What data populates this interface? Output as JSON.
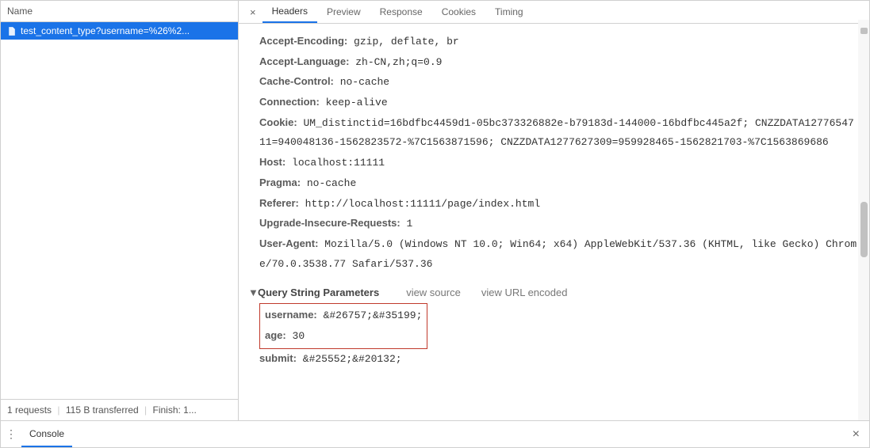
{
  "sidebar": {
    "header": "Name",
    "item_label": "test_content_type?username=%26%2...",
    "footer": {
      "requests": "1 requests",
      "transferred": "115 B transferred",
      "finish": "Finish: 1..."
    }
  },
  "tabs": {
    "headers": "Headers",
    "preview": "Preview",
    "response": "Response",
    "cookies": "Cookies",
    "timing": "Timing"
  },
  "headers": {
    "accept_encoding_k": "Accept-Encoding:",
    "accept_encoding_v": "gzip, deflate, br",
    "accept_language_k": "Accept-Language:",
    "accept_language_v": "zh-CN,zh;q=0.9",
    "cache_control_k": "Cache-Control:",
    "cache_control_v": "no-cache",
    "connection_k": "Connection:",
    "connection_v": "keep-alive",
    "cookie_k": "Cookie:",
    "cookie_v": "UM_distinctid=16bdfbc4459d1-05bc373326882e-b79183d-144000-16bdfbc445a2f; CNZZDATA1277654711=940048136-1562823572-%7C1563871596; CNZZDATA1277627309=959928465-1562821703-%7C1563869686",
    "host_k": "Host:",
    "host_v": "localhost:11111",
    "pragma_k": "Pragma:",
    "pragma_v": "no-cache",
    "referer_k": "Referer:",
    "referer_v": "http://localhost:11111/page/index.html",
    "upgrade_k": "Upgrade-Insecure-Requests:",
    "upgrade_v": "1",
    "user_agent_k": "User-Agent:",
    "user_agent_v": "Mozilla/5.0 (Windows NT 10.0; Win64; x64) AppleWebKit/537.36 (KHTML, like Gecko) Chrome/70.0.3538.77 Safari/537.36"
  },
  "query_section": {
    "title": "Query String Parameters",
    "view_source": "view source",
    "view_encoded": "view URL encoded",
    "params": {
      "username_k": "username:",
      "username_v": "&#26757;&#35199;",
      "age_k": "age:",
      "age_v": "30",
      "submit_k": "submit:",
      "submit_v": "&#25552;&#20132;"
    }
  },
  "console": {
    "label": "Console"
  }
}
